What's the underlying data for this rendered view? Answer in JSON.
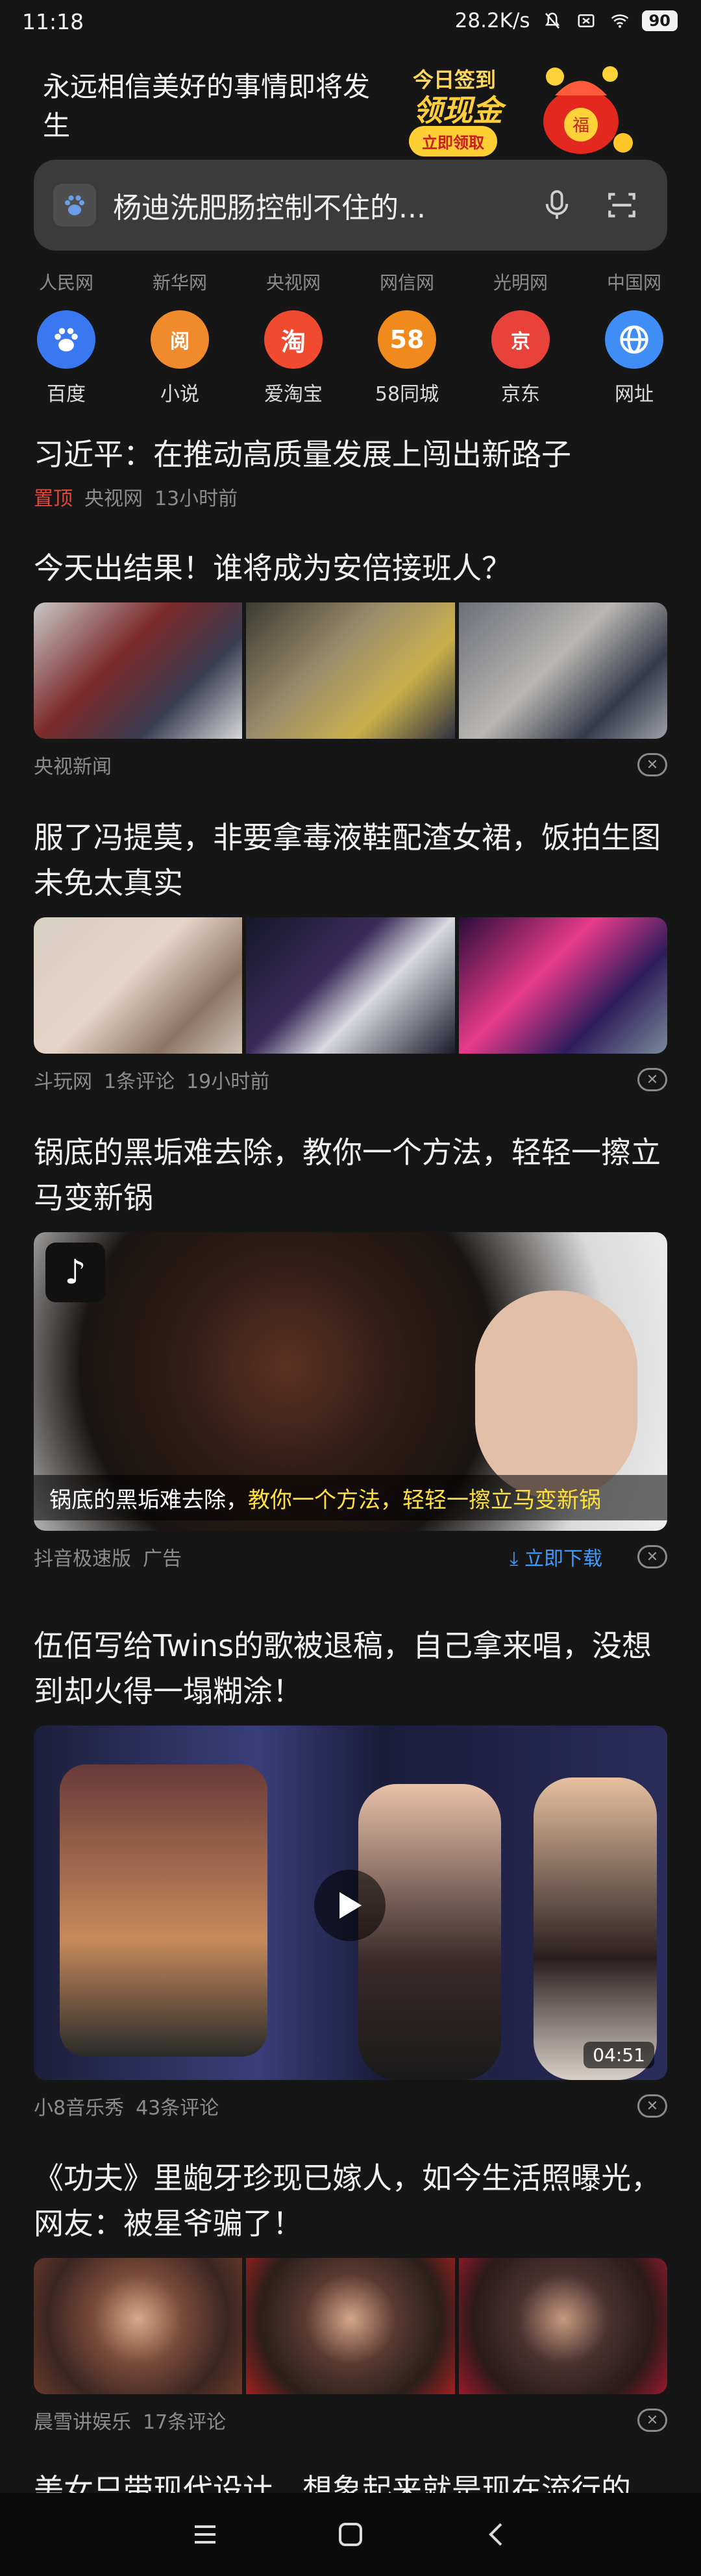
{
  "status_bar": {
    "time": "11:18",
    "network_speed": "28.2K/s",
    "battery": "90"
  },
  "header": {
    "slogan": "永远相信美好的事情即将发生",
    "promo_line1": "今日签到",
    "promo_line2": "领现金",
    "promo_button": "立即领取",
    "promo_bag_text": "福"
  },
  "search": {
    "query": "杨迪洗肥肠控制不住的..."
  },
  "sources": [
    "人民网",
    "新华网",
    "央视网",
    "网信网",
    "光明网",
    "中国网"
  ],
  "apps": [
    {
      "label": "百度",
      "glyph": "🐾",
      "color": "#3a78f2"
    },
    {
      "label": "小说",
      "glyph": "阅",
      "color": "#f08a2c"
    },
    {
      "label": "爱淘宝",
      "glyph": "淘",
      "color": "#f04b2f"
    },
    {
      "label": "58同城",
      "glyph": "58",
      "color": "#f08a1c"
    },
    {
      "label": "京东",
      "glyph": "京",
      "color": "#e8423a"
    },
    {
      "label": "网址",
      "glyph": "◎",
      "color": "#3f8df5"
    }
  ],
  "news": [
    {
      "title": "习近平：在推动高质量发展上闯出新路子",
      "tag": "置顶",
      "source": "央视网",
      "time": "13小时前"
    },
    {
      "title": "今天出结果！谁将成为安倍接班人？",
      "source": "央视新闻"
    },
    {
      "title": "服了冯提莫，非要拿毒液鞋配渣女裙，饭拍生图未免太真实",
      "source": "斗玩网",
      "comments": "1条评论",
      "time": "19小时前"
    },
    {
      "title": "锅底的黑垢难去除，教你一个方法，轻轻一擦立马变新锅",
      "source": "抖音极速版",
      "ad": "广告",
      "download": "立即下载",
      "caption_white": "锅底的黑垢难去除，",
      "caption_yellow": "教你一个方法，轻轻一擦立马变新锅"
    },
    {
      "title": "伍佰写给Twins的歌被退稿，自己拿来唱，没想到却火得一塌糊涂！",
      "source": "小8音乐秀",
      "comments": "43条评论",
      "duration": "04:51"
    },
    {
      "title": "《功夫》里龅牙珍现已嫁人，如今生活照曝光，网友：被星爷骗了！",
      "source": "晨雪讲娱乐",
      "comments": "17条评论"
    },
    {
      "title": "美女只带现代设计，想象起来就是现在流行的"
    }
  ]
}
